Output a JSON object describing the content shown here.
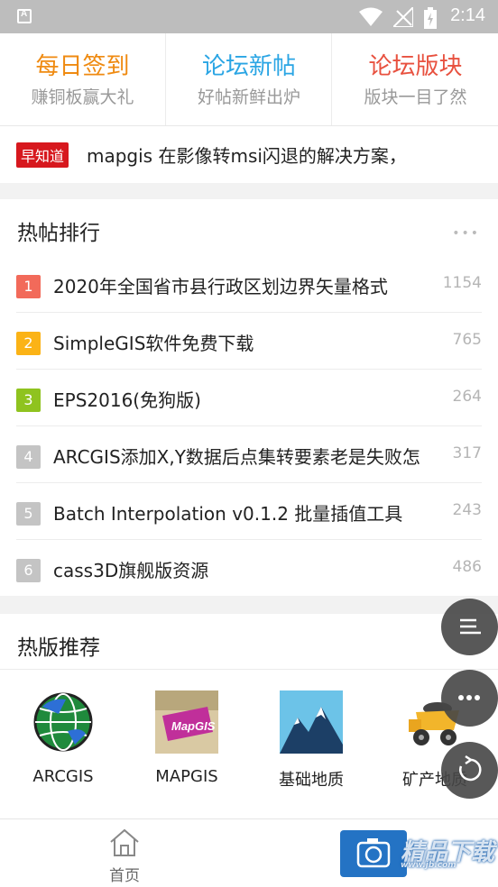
{
  "status_bar": {
    "time": "2:14"
  },
  "top_nav": [
    {
      "title": "每日签到",
      "subtitle": "赚铜板赢大礼",
      "color": "#ef8a10"
    },
    {
      "title": "论坛新帖",
      "subtitle": "好帖新鲜出炉",
      "color": "#2aa5e4"
    },
    {
      "title": "论坛版块",
      "subtitle": "版块一目了然",
      "color": "#e8513f"
    }
  ],
  "news": {
    "badge": "早知道",
    "text": "mapgis 在影像转msi闪退的解决方案，"
  },
  "hot_posts": {
    "header": "热帖排行",
    "more": "•••",
    "items": [
      {
        "rank": "1",
        "title": "2020年全国省市县行政区划边界矢量格式",
        "count": "1154",
        "color": "#f26a5a"
      },
      {
        "rank": "2",
        "title": "SimpleGIS软件免费下载",
        "count": "765",
        "color": "#fbb316"
      },
      {
        "rank": "3",
        "title": "EPS2016(免狗版)",
        "count": "264",
        "color": "#8fc31f"
      },
      {
        "rank": "4",
        "title": "ARCGIS添加X,Y数据后点集转要素老是失败怎",
        "count": "317",
        "color": "#c4c4c4"
      },
      {
        "rank": "5",
        "title": "Batch Interpolation v0.1.2 批量插值工具",
        "count": "243",
        "color": "#c4c4c4"
      },
      {
        "rank": "6",
        "title": "cass3D旗舰版资源",
        "count": "486",
        "color": "#c4c4c4"
      }
    ]
  },
  "hot_boards": {
    "header": "热版推荐",
    "items": [
      {
        "label": "ARCGIS",
        "icon": "globe-icon"
      },
      {
        "label": "MAPGIS",
        "icon": "mapgis-logo-icon"
      },
      {
        "label": "基础地质",
        "icon": "mountain-icon"
      },
      {
        "label": "矿产地质",
        "icon": "dump-truck-icon"
      }
    ]
  },
  "bottom_nav": {
    "home_label": "首页"
  },
  "watermark": {
    "text": "精品下载",
    "url": "www.jb.com"
  }
}
